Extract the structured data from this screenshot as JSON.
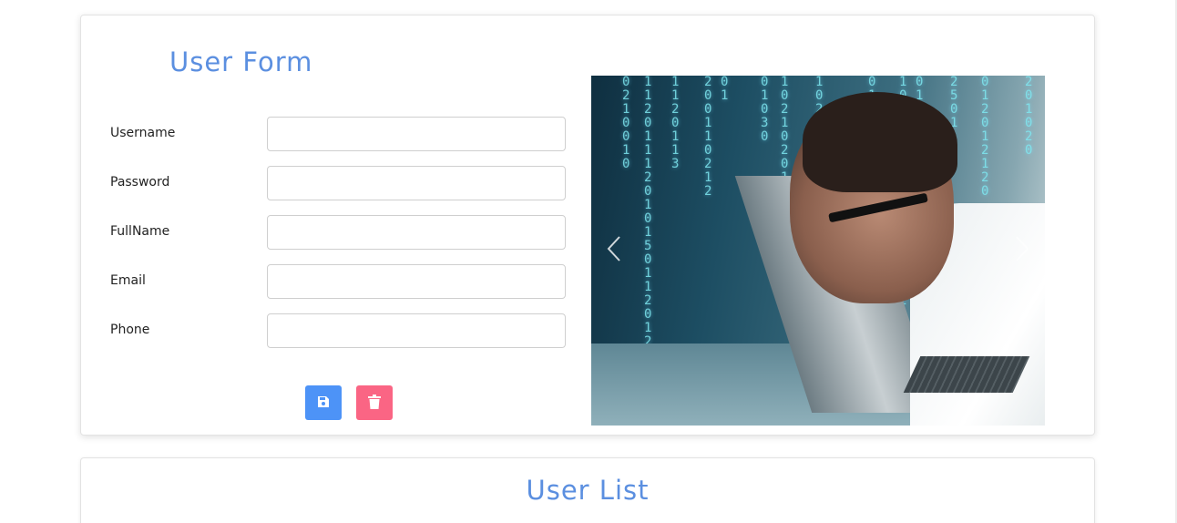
{
  "form": {
    "title": "User Form",
    "fields": [
      {
        "label": "Username",
        "value": "",
        "placeholder": ""
      },
      {
        "label": "Password",
        "value": "",
        "placeholder": ""
      },
      {
        "label": "FullName",
        "value": "",
        "placeholder": ""
      },
      {
        "label": "Email",
        "value": "",
        "placeholder": ""
      },
      {
        "label": "Phone",
        "value": "",
        "placeholder": ""
      }
    ],
    "buttons": {
      "save_icon": "save-icon",
      "delete_icon": "trash-icon"
    }
  },
  "carousel": {
    "image": "man-peering-into-laptop-binary-code",
    "prev_icon": "chevron-left-icon",
    "next_icon": "chevron-right-icon"
  },
  "list": {
    "title": "User List"
  },
  "colors": {
    "title": "#5b8fe0",
    "save_button": "#4d93f7",
    "delete_button": "#fa6584"
  }
}
